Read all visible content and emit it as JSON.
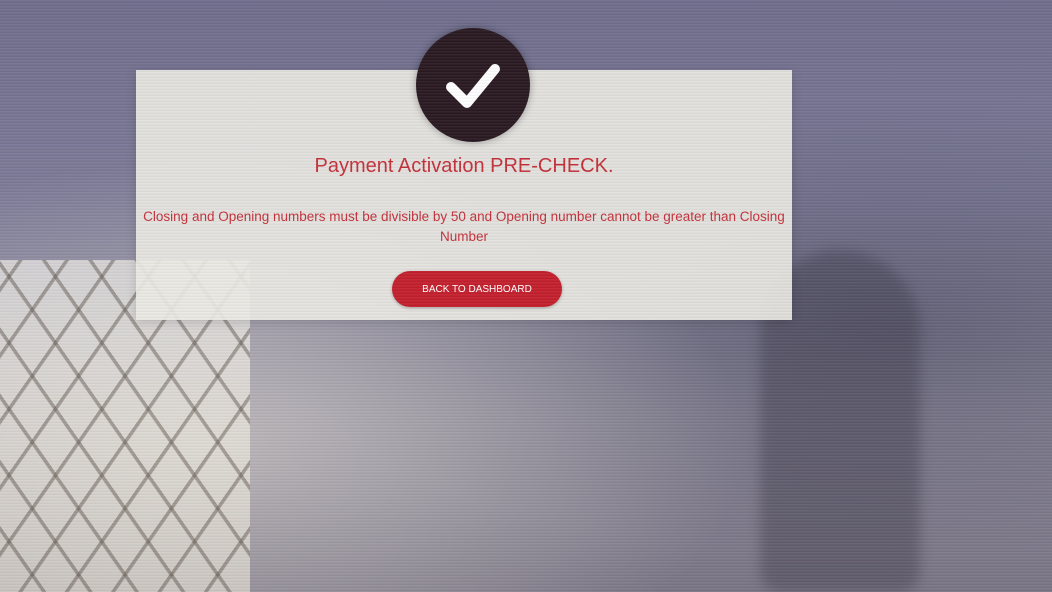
{
  "dialog": {
    "icon": "checkmark-icon",
    "title": "Payment Activation PRE-CHECK.",
    "message": "Closing and Opening numbers must be divisible by 50 and Opening number cannot be greater than Closing Number",
    "button_label": "BACK TO DASHBOARD"
  },
  "colors": {
    "accent": "#c4202e",
    "text": "#c4303a",
    "icon_bg": "#2a1a22"
  }
}
